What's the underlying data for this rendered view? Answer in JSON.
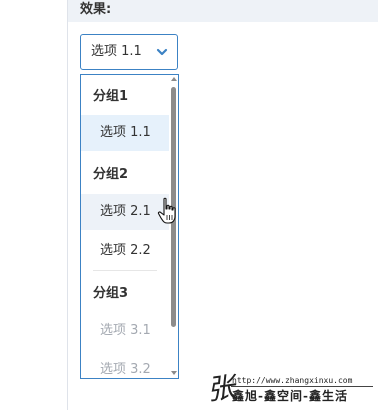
{
  "header": {
    "label": "效果:"
  },
  "select": {
    "value": "选项 1.1",
    "icon": "chevron-down-icon",
    "accent_color": "#3c82c4"
  },
  "dropdown": {
    "groups": [
      {
        "label": "分组1",
        "options": [
          {
            "label": "选项 1.1",
            "state": "selected"
          }
        ]
      },
      {
        "label": "分组2",
        "options": [
          {
            "label": "选项 2.1",
            "state": "hovered"
          },
          {
            "label": "选项 2.2",
            "state": "normal"
          }
        ]
      },
      {
        "label": "分组3",
        "options": [
          {
            "label": "选项 3.1",
            "state": "disabled"
          },
          {
            "label": "选项 3.2",
            "state": "disabled"
          }
        ]
      }
    ],
    "selected_bg": "#e6f1fb",
    "disabled_color": "#a4a9b1"
  },
  "watermark": {
    "glyph": "张",
    "url": "http://www.zhangxinxu.com",
    "name": "鑫旭-鑫空间-鑫生活"
  }
}
